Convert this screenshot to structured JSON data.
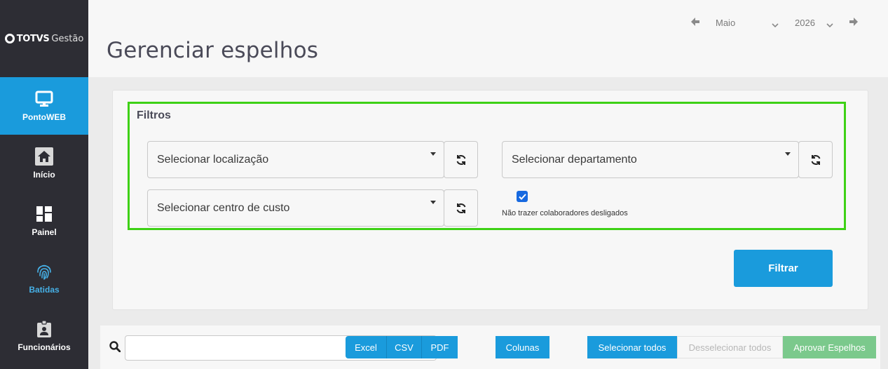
{
  "brand": {
    "name": "TOTVS",
    "sub": "Gestão"
  },
  "sidebar": {
    "items": [
      {
        "label": "PontoWEB",
        "icon": "monitor-icon",
        "active": true
      },
      {
        "label": "Início",
        "icon": "home-icon"
      },
      {
        "label": "Painel",
        "icon": "dashboard-icon"
      },
      {
        "label": "Batidas",
        "icon": "fingerprint-icon"
      },
      {
        "label": "Funcionários",
        "icon": "badge-icon"
      }
    ]
  },
  "header": {
    "title": "Gerenciar espelhos",
    "month": "Maio",
    "year": "2026"
  },
  "filters": {
    "title": "Filtros",
    "location_placeholder": "Selecionar localização",
    "department_placeholder": "Selecionar departamento",
    "cost_center_placeholder": "Selecionar centro de custo",
    "exclude_dismissed_label": "Não trazer colaboradores desligados",
    "exclude_dismissed_checked": true,
    "filter_button": "Filtrar"
  },
  "toolbar": {
    "search_value": "",
    "export": [
      "Excel",
      "CSV",
      "PDF"
    ],
    "columns": "Colunas",
    "select_all": "Selecionar todos",
    "deselect_all": "Desselecionar todos",
    "approve": "Aprovar Espelhos"
  },
  "colors": {
    "sidebar_bg": "#2d2d34",
    "accent": "#1a9bdc",
    "highlight_border": "#3ed116",
    "approve_green": "#7bc98c"
  }
}
